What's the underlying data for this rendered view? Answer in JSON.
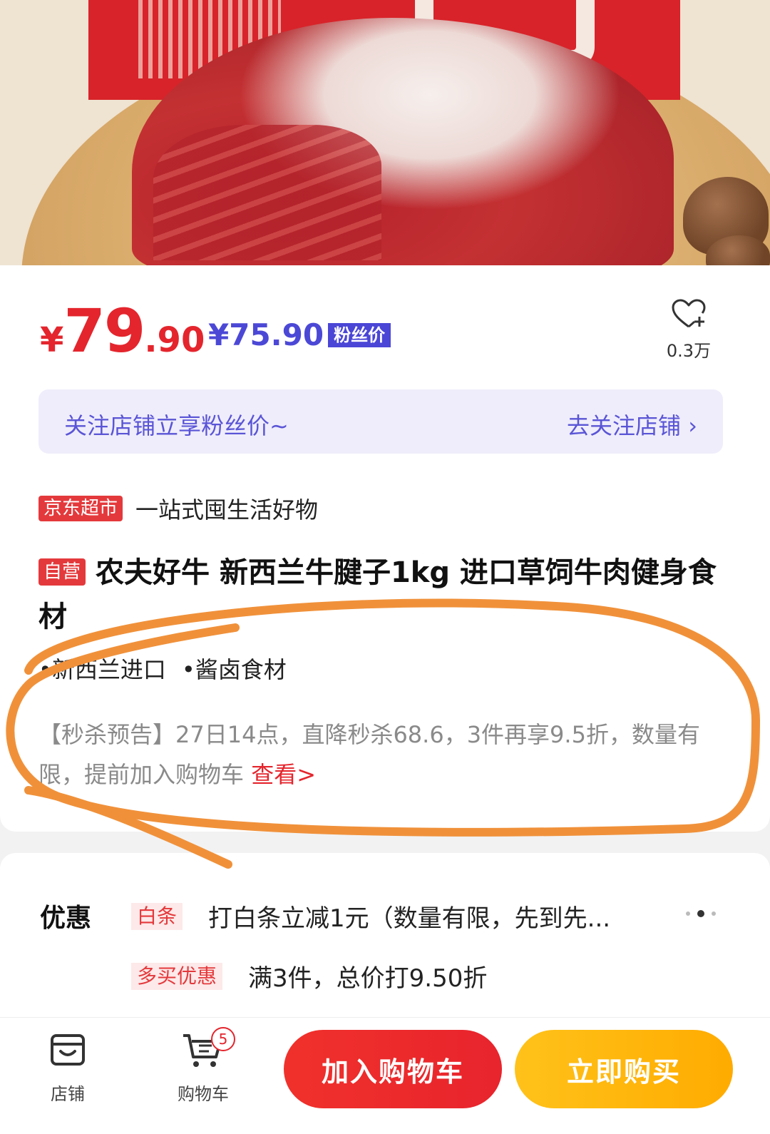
{
  "price": {
    "currency": "¥",
    "integer": "79",
    "decimal": ".90",
    "fan_price": "¥75.90",
    "fan_price_tag": "粉丝价"
  },
  "favorite": {
    "count": "0.3万"
  },
  "follow_bar": {
    "text": "关注店铺立享粉丝价~",
    "action": "去关注店铺 ›"
  },
  "store": {
    "badge": "京东超市",
    "slogan": "一站式囤生活好物"
  },
  "product": {
    "badge": "自营",
    "title": "农夫好牛 新西兰牛腱子1kg 进口草饲牛肉健身食材",
    "features": [
      "•新西兰进口",
      "•酱卤食材"
    ],
    "promo_text": "【秒杀预告】27日14点，直降秒杀68.6，3件再享9.5折，数量有限，提前加入购物车",
    "promo_link": "查看>"
  },
  "coupons": {
    "title": "优惠",
    "items": [
      {
        "tag": "白条",
        "text": "打白条立减1元（数量有限，先到先..."
      },
      {
        "tag": "多买优惠",
        "text": "满3件，总价打9.50折"
      }
    ]
  },
  "bottom_bar": {
    "store_label": "店铺",
    "cart_label": "购物车",
    "cart_count": "5",
    "add_to_cart": "加入购物车",
    "buy_now": "立即购买"
  },
  "colors": {
    "price_red": "#e4252d",
    "fan_purple": "#4b46d6",
    "add_button": "#e8242d",
    "buy_button": "#ffab00",
    "annotation_orange": "#f0913a"
  },
  "icons": [
    "heart-plus-icon",
    "store-icon",
    "cart-icon",
    "more-dots-icon"
  ]
}
